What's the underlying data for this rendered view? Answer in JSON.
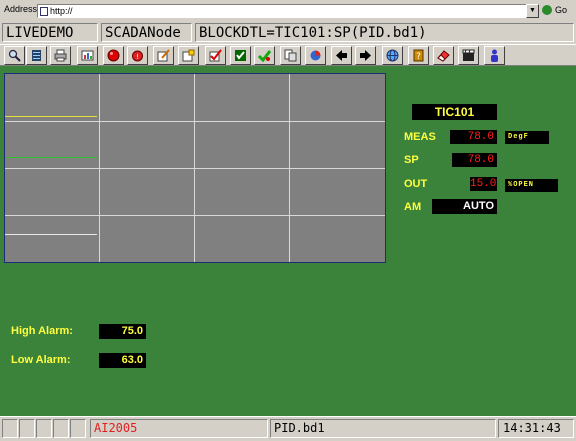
{
  "address_bar": {
    "label": "Address",
    "url": "http://",
    "go_label": "Go"
  },
  "title_bar": {
    "app": "LIVEDEMO",
    "node": "SCADANode",
    "block": "BLOCKDTL=TIC101:SP(PID.bd1)"
  },
  "toolbar": {
    "buttons": [
      {
        "icon": "magnifier-icon"
      },
      {
        "icon": "database-icon"
      },
      {
        "icon": "printer-icon"
      },
      {
        "icon": "report-icon"
      },
      {
        "icon": "red-ball-icon"
      },
      {
        "icon": "red-alarm-icon"
      },
      {
        "icon": "edit-tag-icon"
      },
      {
        "icon": "lock-tag-icon"
      },
      {
        "icon": "checkbox-icon"
      },
      {
        "icon": "checkmark-icon"
      },
      {
        "icon": "pages-icon"
      },
      {
        "icon": "graph-icon"
      },
      {
        "icon": "arrow-left-icon"
      },
      {
        "icon": "arrow-right-icon"
      },
      {
        "icon": "globe-icon"
      },
      {
        "icon": "book-icon"
      },
      {
        "icon": "eraser-icon"
      },
      {
        "icon": "clapper-icon"
      },
      {
        "icon": "user-icon"
      }
    ]
  },
  "faceplate": {
    "tag": "TIC101",
    "meas": {
      "label": "MEAS",
      "value": "78.0",
      "unit": "DegF"
    },
    "sp": {
      "label": "SP",
      "value": "78.0"
    },
    "out": {
      "label": "OUT",
      "value": "15.0",
      "unit": "%OPEN"
    },
    "am": {
      "label": "AM",
      "value": "AUTO"
    }
  },
  "alarms": {
    "high": {
      "label": "High Alarm:",
      "value": "75.0"
    },
    "low": {
      "label": "Low Alarm:",
      "value": "63.0"
    }
  },
  "status_bar": {
    "alarm_tag": "AI2005",
    "file": "PID.bd1",
    "time": "14:31:43"
  },
  "colors": {
    "panel_green": "#3b823b",
    "label_yellow": "#ffff40",
    "value_red": "#ff2020",
    "trend_bg": "#808080",
    "trace_meas": "#e8e040",
    "trace_sp": "#30c030"
  }
}
